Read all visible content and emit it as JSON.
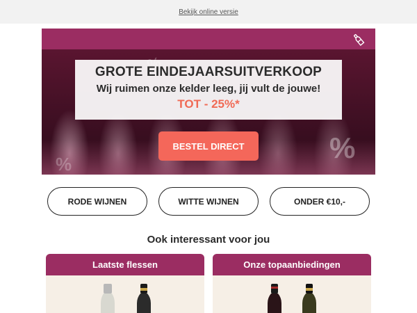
{
  "topbar": {
    "view_online": "Bekijk online versie"
  },
  "hero": {
    "title": "GROTE EINDEJAARSUITVERKOOP",
    "subtitle": "Wij ruimen onze kelder leeg, jij vult de jouwe!",
    "discount": "TOT - 25%*",
    "cta_label": "BESTEL DIRECT",
    "brand_color": "#9b2d62",
    "accent_color": "#f4675a"
  },
  "categories": [
    {
      "label": "RODE WIJNEN"
    },
    {
      "label": "WITTE WIJNEN"
    },
    {
      "label": "ONDER €10,-"
    }
  ],
  "recommendations": {
    "heading": "Ook interessant voor jou",
    "cards": [
      {
        "title": "Laatste flessen"
      },
      {
        "title": "Onze topaanbiedingen"
      }
    ]
  },
  "icons": {
    "hero_corner": "wine-bottle-icon"
  }
}
